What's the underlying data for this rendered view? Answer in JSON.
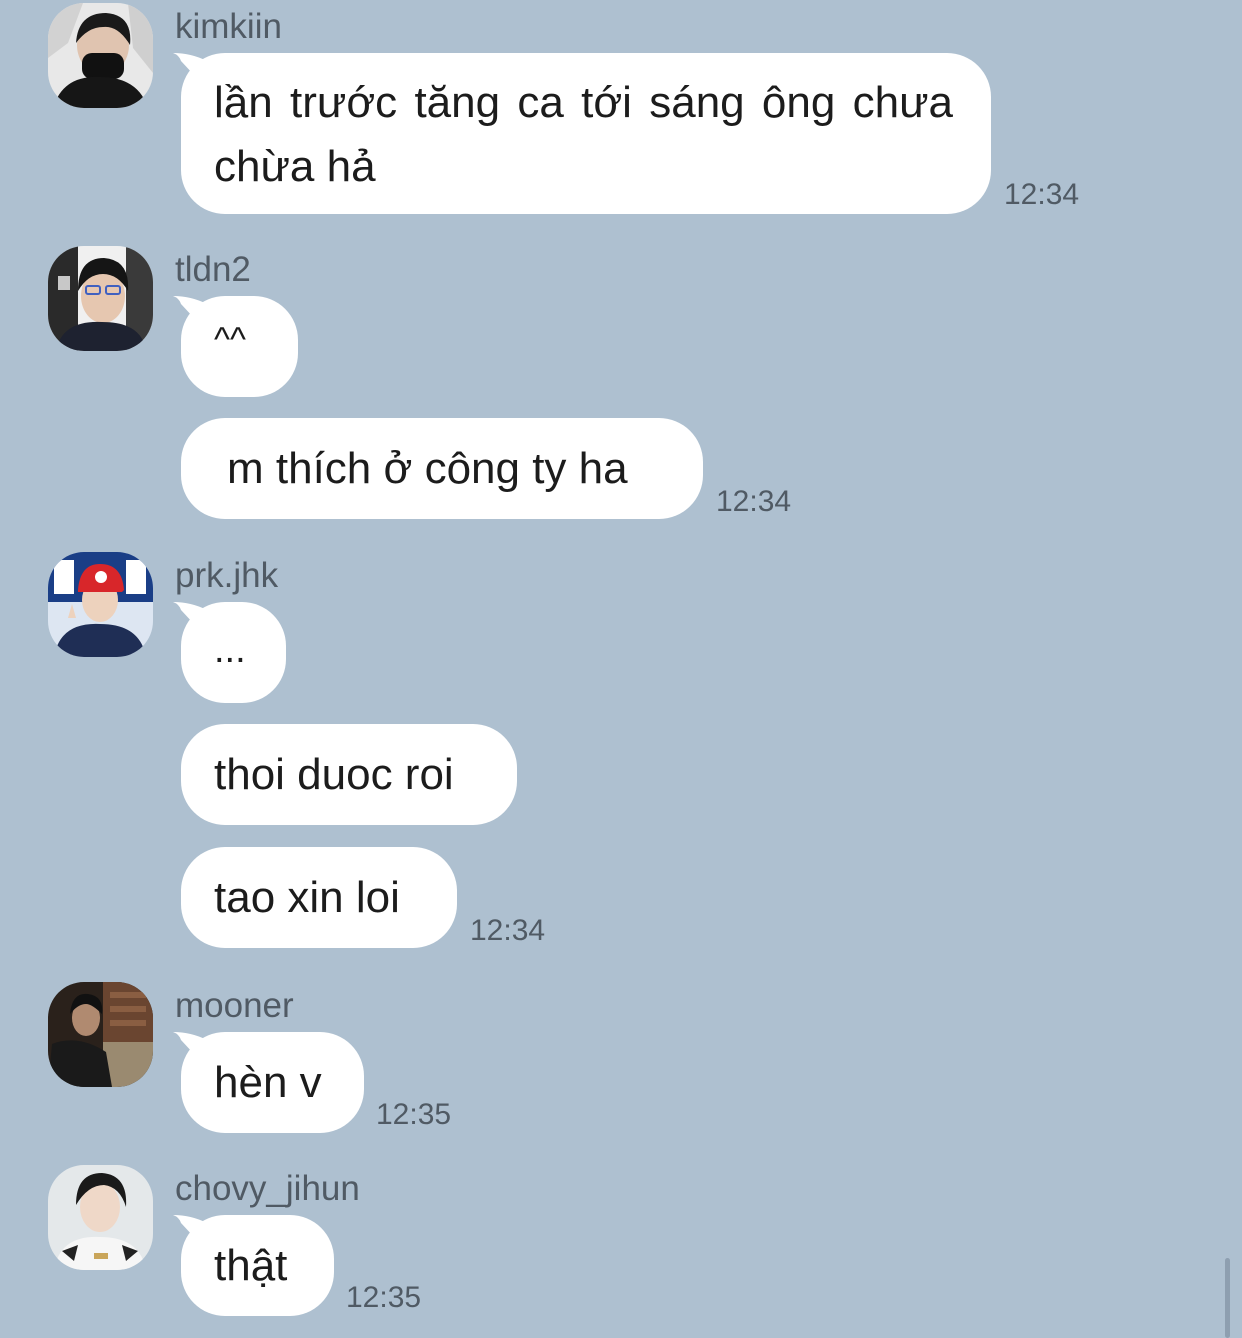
{
  "messages": [
    {
      "sender": "kimkiin",
      "avatar": "avatar-kimkiin",
      "bubbles": [
        "lần trước tăng ca tới sáng ông chưa chừa hả"
      ],
      "time": "12:34"
    },
    {
      "sender": "tldn2",
      "avatar": "avatar-tldn2",
      "bubbles": [
        "^^",
        "m thích ở công ty ha"
      ],
      "time": "12:34"
    },
    {
      "sender": "prk.jhk",
      "avatar": "avatar-prk-jhk",
      "bubbles": [
        "...",
        "thoi duoc roi",
        "tao xin loi"
      ],
      "time": "12:34"
    },
    {
      "sender": "mooner",
      "avatar": "avatar-mooner",
      "bubbles": [
        "hèn v"
      ],
      "time": "12:35"
    },
    {
      "sender": "chovy_jihun",
      "avatar": "avatar-chovy-jihun",
      "bubbles": [
        "thật"
      ],
      "time": "12:35"
    }
  ],
  "colors": {
    "background": "#aec0d0",
    "bubble": "#ffffff",
    "meta_text": "#505a64"
  }
}
